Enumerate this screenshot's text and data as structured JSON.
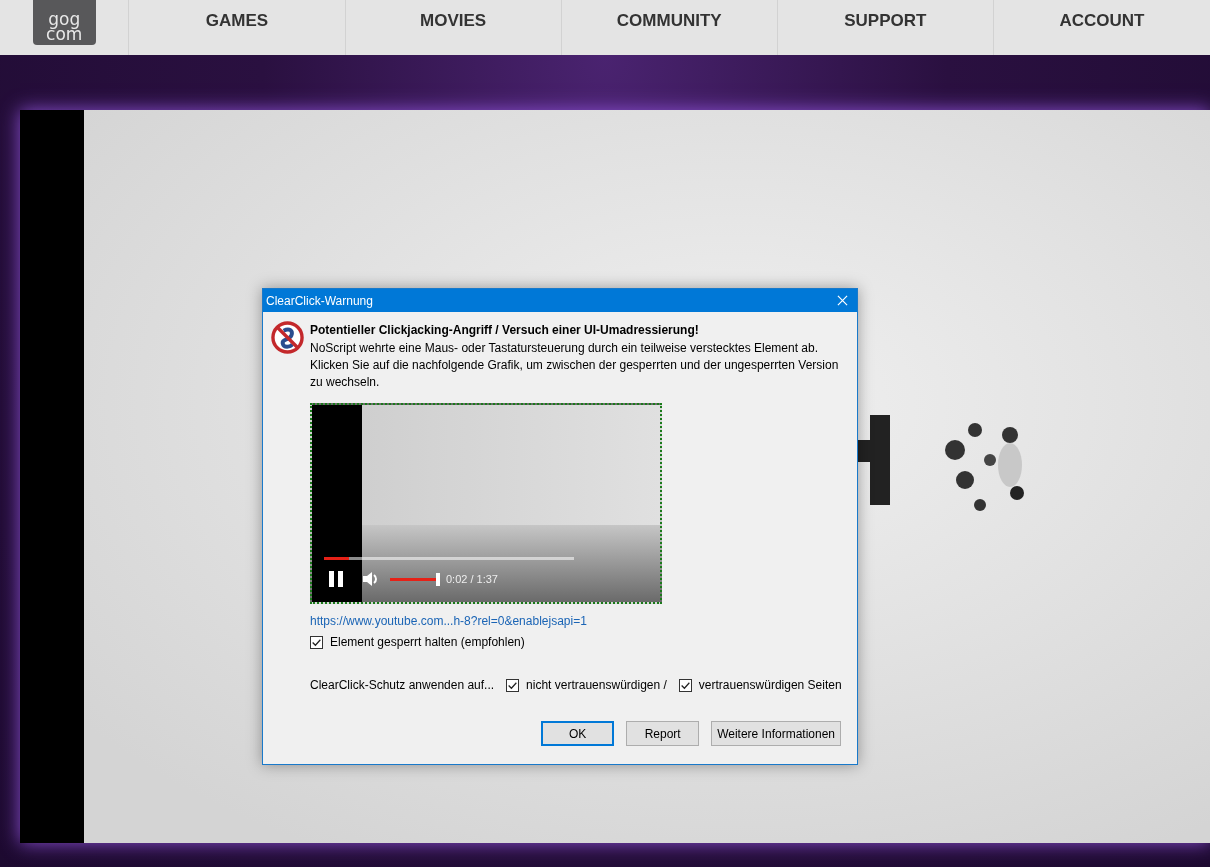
{
  "nav": {
    "logo": [
      "gog",
      "com"
    ],
    "items": [
      {
        "label": "GAMES"
      },
      {
        "label": "MOVIES"
      },
      {
        "label": "COMMUNITY"
      },
      {
        "label": "SUPPORT"
      },
      {
        "label": "ACCOUNT"
      }
    ]
  },
  "dialog": {
    "title": "ClearClick-Warnung",
    "heading": "Potentieller Clickjacking-Angriff / Versuch einer UI-Umadressierung!",
    "message": "NoScript wehrte eine Maus- oder Tastatursteuerung durch ein teilweise verstecktes Element ab. Klicken Sie auf die nachfolgende Grafik, um zwischen der gesperrten und der ungesperrten Version zu wechseln.",
    "preview": {
      "time": "0:02 / 1:37",
      "progress": {
        "level": 0.1
      },
      "volume": {
        "level": 1
      }
    },
    "url": "https://www.youtube.com...h-8?rel=0&enablejsapi=1",
    "keep_locked": {
      "label": "Element gesperrt halten (empfohlen)",
      "checked": true
    },
    "apply_label": "ClearClick-Schutz anwenden auf...",
    "apply_options": [
      {
        "label": "nicht vertrauenswürdigen /",
        "checked": true
      },
      {
        "label": "vertrauenswürdigen Seiten",
        "checked": true
      }
    ],
    "buttons": [
      {
        "label": "OK",
        "kind": "default"
      },
      {
        "label": "Report",
        "kind": "normal"
      },
      {
        "label": "Weitere Informationen",
        "kind": "normal"
      }
    ]
  }
}
